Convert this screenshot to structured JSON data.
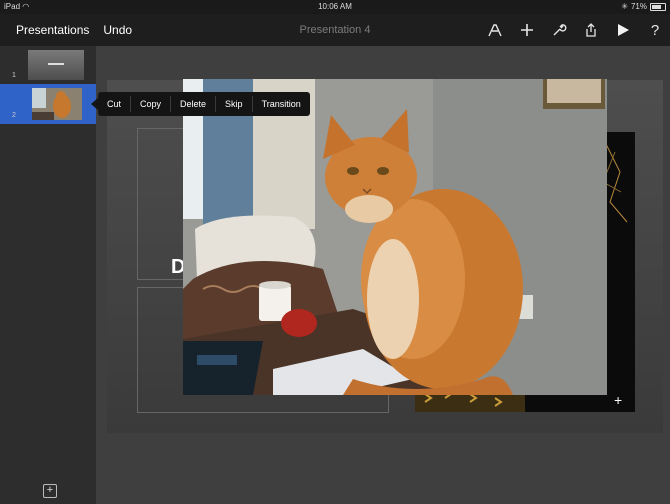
{
  "status_bar": {
    "device": "iPad",
    "time": "10:06 AM",
    "battery": "71%"
  },
  "toolbar": {
    "presentations_label": "Presentations",
    "undo_label": "Undo",
    "title": "Presentation 4",
    "icons": [
      "format-brush-icon",
      "add-icon",
      "tools-wrench-icon",
      "share-icon",
      "play-icon",
      "help-icon"
    ],
    "help_glyph": "?"
  },
  "sidebar": {
    "slides": [
      {
        "number": "1"
      },
      {
        "number": "2",
        "selected": true
      }
    ],
    "add_slide_glyph": "+"
  },
  "context_menu": {
    "items": [
      "Cut",
      "Copy",
      "Delete",
      "Skip",
      "Transition"
    ]
  },
  "slide": {
    "placeholder_text": "D"
  },
  "colors": {
    "accent": "#2f63c8",
    "toolbar": "#1e1e1e",
    "menu": "#141414"
  }
}
